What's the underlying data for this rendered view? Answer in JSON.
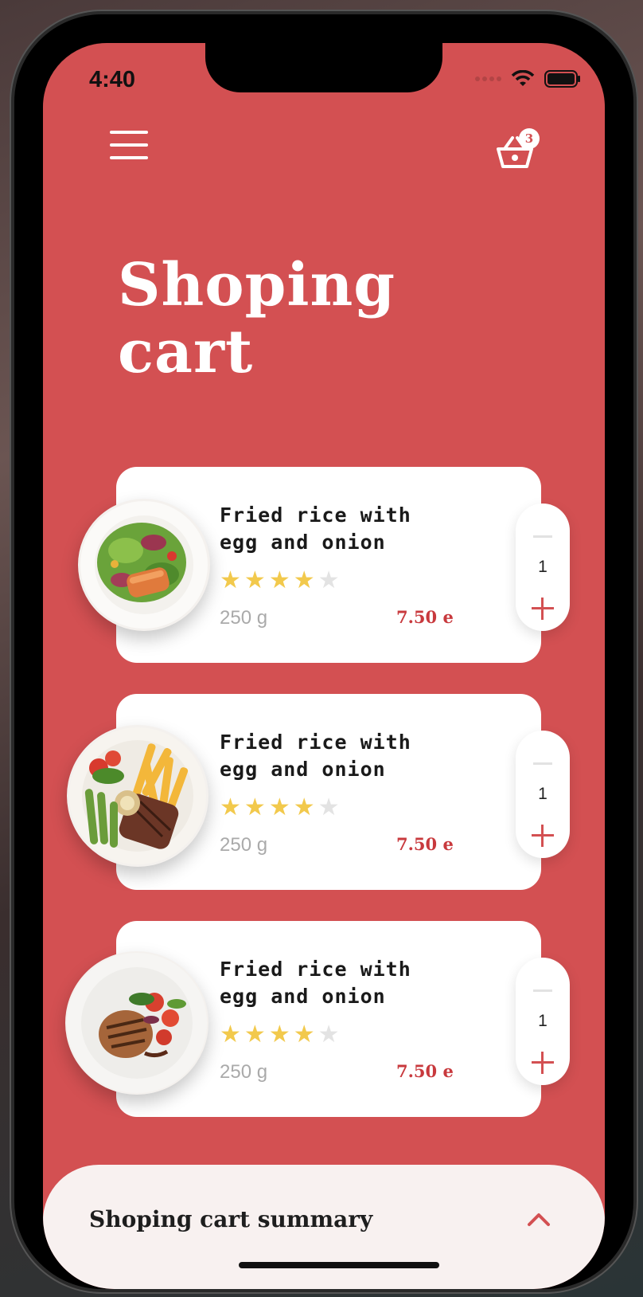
{
  "status": {
    "time": "4:40"
  },
  "header": {
    "cart_count": "3"
  },
  "page": {
    "title_line1": "Shoping",
    "title_line2": "cart"
  },
  "items": [
    {
      "name": "Fried rice with egg and onion",
      "rating": 4,
      "max_rating": 5,
      "weight": "250 g",
      "price": "7.50 e",
      "quantity": "1",
      "image": "salmon-salad-plate"
    },
    {
      "name": "Fried rice with egg and onion",
      "rating": 4,
      "max_rating": 5,
      "weight": "250 g",
      "price": "7.50 e",
      "quantity": "1",
      "image": "steak-fries-plate"
    },
    {
      "name": "Fried rice with egg and onion",
      "rating": 4,
      "max_rating": 5,
      "weight": "250 g",
      "price": "7.50 e",
      "quantity": "1",
      "image": "grilled-chicken-plate"
    }
  ],
  "summary": {
    "label": "Shoping cart summary"
  },
  "colors": {
    "accent": "#d35052",
    "star": "#f2c94c",
    "star_empty": "#e3e3e3",
    "price": "#c8393d"
  },
  "icons": {
    "menu": "hamburger-menu-icon",
    "cart": "basket-icon",
    "expand": "chevron-up-icon"
  }
}
